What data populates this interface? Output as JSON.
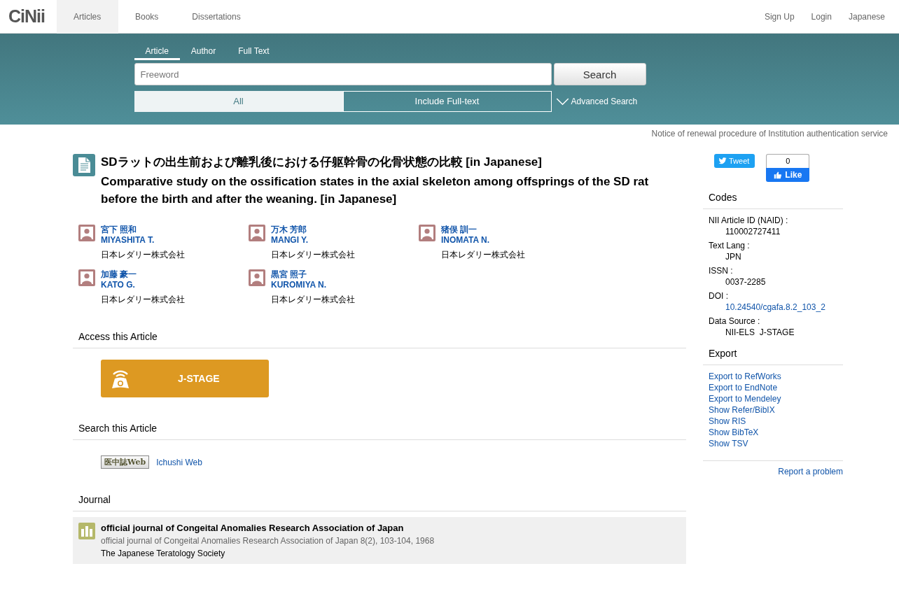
{
  "logo": "CiNii",
  "nav": [
    {
      "label": "Articles",
      "selected": true
    },
    {
      "label": "Books",
      "selected": false
    },
    {
      "label": "Dissertations",
      "selected": false
    }
  ],
  "nav_right": [
    "Sign Up",
    "Login",
    "Japanese"
  ],
  "search": {
    "tabs": [
      {
        "label": "Article",
        "selected": true
      },
      {
        "label": "Author",
        "selected": false
      },
      {
        "label": "Full Text",
        "selected": false
      }
    ],
    "placeholder": "Freeword",
    "button": "Search",
    "scopes": [
      {
        "label": "All",
        "selected": true
      },
      {
        "label": "Include Full-text",
        "selected": false
      }
    ],
    "advanced": "Advanced Search"
  },
  "notice": "Notice of renewal procedure of Institution authentication service",
  "article": {
    "title_ja": "SDラットの出生前および離乳後における仔躯幹骨の化骨状態の比較  [in Japanese]",
    "title_en": "Comparative study on the ossification states in the axial skeleton among offsprings of the SD rat before the birth and after the weaning.  [in Japanese]",
    "authors": [
      {
        "name_ja": "宮下 照和",
        "name_en": "MIYASHITA T.",
        "affiliation": "日本レダリー株式会社"
      },
      {
        "name_ja": "万木 芳郎",
        "name_en": "MANGI Y.",
        "affiliation": "日本レダリー株式会社"
      },
      {
        "name_ja": "猪俣 訓一",
        "name_en": "INOMATA N.",
        "affiliation": "日本レダリー株式会社"
      },
      {
        "name_ja": "加藤 豪一",
        "name_en": "KATO G.",
        "affiliation": "日本レダリー株式会社"
      },
      {
        "name_ja": "黒宮 照子",
        "name_en": "KUROMIYA N.",
        "affiliation": "日本レダリー株式会社"
      }
    ]
  },
  "access": {
    "heading": "Access this Article",
    "button": "J-STAGE"
  },
  "search_article": {
    "heading": "Search this Article",
    "badge": "医中誌Web",
    "link": "Ichushi Web"
  },
  "journal": {
    "heading": "Journal",
    "title": "official journal of Congeital Anomalies Research Association of Japan",
    "citation": "official journal of Congeital Anomalies Research Association of Japan 8(2), 103-104, 1968",
    "publisher": "The Japanese Teratology Society"
  },
  "social": {
    "tweet": "Tweet",
    "like_count": "0",
    "like": "Like"
  },
  "codes": {
    "heading": "Codes",
    "items": [
      {
        "label": "NII Article ID (NAID) :",
        "value": "110002727411",
        "kind": "text"
      },
      {
        "label": "Text Lang :",
        "value": "JPN",
        "kind": "text"
      },
      {
        "label": "ISSN :",
        "value": "0037-2285",
        "kind": "text"
      },
      {
        "label": "DOI :",
        "value": "10.24540/cgafa.8.2_103_2",
        "kind": "link"
      },
      {
        "label": "Data Source :",
        "value": "NII-ELS  J-STAGE",
        "kind": "text"
      }
    ]
  },
  "export": {
    "heading": "Export",
    "links": [
      "Export to RefWorks",
      "Export to EndNote",
      "Export to Mendeley",
      "Show Refer/BibIX",
      "Show RIS",
      "Show BibTeX",
      "Show TSV"
    ]
  },
  "report": "Report a problem"
}
